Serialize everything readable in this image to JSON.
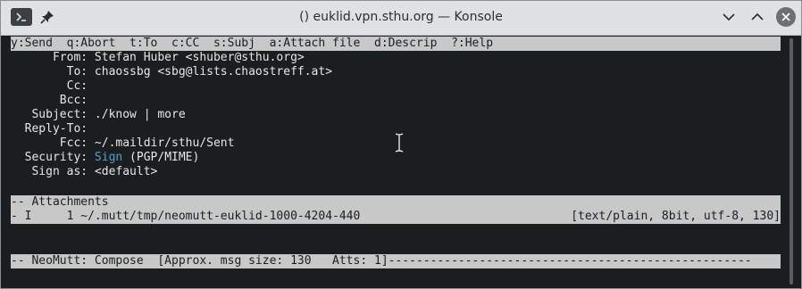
{
  "window": {
    "title": "() euklid.vpn.sthu.org — Konsole",
    "icons": [
      "terminal-icon",
      "pin-icon",
      "minimize-icon",
      "maximize-icon",
      "close-icon"
    ]
  },
  "help_bar": "y:Send  q:Abort  t:To  c:CC  s:Subj  a:Attach file  d:Descrip  ?:Help",
  "headers": [
    {
      "label": "      From:",
      "value": " Stefan Huber <shuber@sthu.org>"
    },
    {
      "label": "        To:",
      "value": " chaossbg <sbg@lists.chaostreff.at>"
    },
    {
      "label": "        Cc:",
      "value": ""
    },
    {
      "label": "       Bcc:",
      "value": ""
    },
    {
      "label": "   Subject:",
      "value": " ./know | more"
    },
    {
      "label": "  Reply-To:",
      "value": ""
    },
    {
      "label": "       Fcc:",
      "value": " ~/.maildir/sthu/Sent"
    },
    {
      "label": "  Security:",
      "value": " (PGP/MIME)",
      "accent": " Sign"
    },
    {
      "label": "   Sign as:",
      "value": " <default>"
    }
  ],
  "attachments_bar": "-- Attachments",
  "attachment": {
    "left": "- I     1 ~/.mutt/tmp/neomutt-euklid-1000-4204-440",
    "right": "[text/plain, 8bit, utf-8, 130]"
  },
  "status_bar": "-- NeoMutt: Compose  [Approx. msg size: 130   Atts: 1]----------------------------------------------------"
}
